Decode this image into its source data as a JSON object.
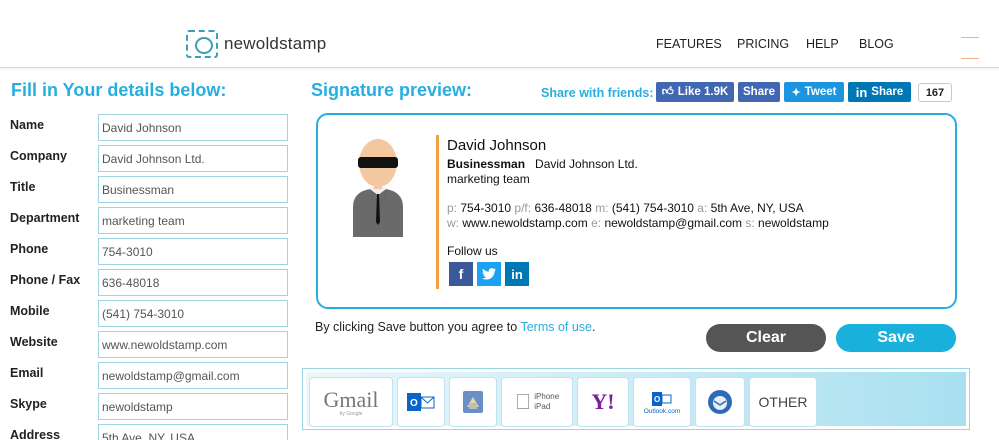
{
  "header": {
    "logo_text": "newoldstamp",
    "nav": [
      "FEATURES",
      "PRICING",
      "HELP",
      "BLOG"
    ]
  },
  "form": {
    "title": "Fill in Your details below:",
    "fields": [
      {
        "label": "Name",
        "value": "David Johnson"
      },
      {
        "label": "Company",
        "value": "David Johnson Ltd."
      },
      {
        "label": "Title",
        "value": "Businessman"
      },
      {
        "label": "Department",
        "value": "marketing team"
      },
      {
        "label": "Phone",
        "value": "754-3010"
      },
      {
        "label": "Phone / Fax",
        "value": "636-48018"
      },
      {
        "label": "Mobile",
        "value": "(541) 754-3010"
      },
      {
        "label": "Website",
        "value": "www.newoldstamp.com"
      },
      {
        "label": "Email",
        "value": "newoldstamp@gmail.com"
      },
      {
        "label": "Skype",
        "value": "newoldstamp"
      },
      {
        "label": "Address",
        "value": "5th Ave, NY, USA"
      }
    ]
  },
  "preview": {
    "title": "Signature preview:",
    "share_label": "Share with friends:",
    "fb_like": "Like 1.9K",
    "fb_share": "Share",
    "tweet": "Tweet",
    "li_share": "Share",
    "li_count": "167",
    "signature": {
      "name": "David Johnson",
      "title": "Businessman",
      "company": "David Johnson Ltd.",
      "department": "marketing team",
      "p_label": "p:",
      "phone": "754-3010",
      "pf_label": "p/f:",
      "fax": "636-48018",
      "m_label": "m:",
      "mobile": "(541) 754-3010",
      "a_label": "a:",
      "address": "5th Ave, NY, USA",
      "w_label": "w:",
      "website": "www.newoldstamp.com",
      "e_label": "e:",
      "email": "newoldstamp@gmail.com",
      "s_label": "s:",
      "skype": "newoldstamp",
      "follow": "Follow us"
    },
    "agree_text": "By clicking Save button you agree to ",
    "terms_link": "Terms of use",
    "agree_end": ".",
    "clear": "Clear",
    "save": "Save"
  },
  "clients": {
    "gmail": "Gmail",
    "gmail_sub": "by Google",
    "iphone": "iPhone",
    "ipad": "iPad",
    "yahoo": "Y!",
    "outlook_com": "Outlook.com",
    "other": "OTHER"
  },
  "colors": {
    "accent": "#27aee0",
    "divider": "#f0a040",
    "facebook": "#3b5998",
    "twitter": "#1da1f2",
    "linkedin": "#0077b5"
  }
}
